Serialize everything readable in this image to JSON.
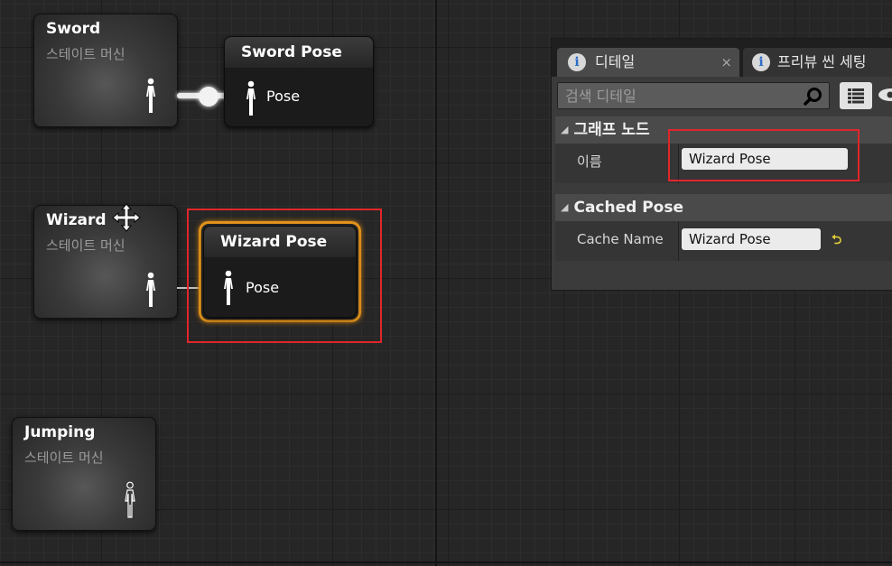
{
  "graph": {
    "state_machines": [
      {
        "title": "Sword",
        "subtitle": "스테이트 머신"
      },
      {
        "title": "Wizard",
        "subtitle": "스테이트 머신"
      },
      {
        "title": "Jumping",
        "subtitle": "스테이트 머신"
      }
    ],
    "pose_nodes": [
      {
        "title": "Sword Pose",
        "pin_label": "Pose"
      },
      {
        "title": "Wizard Pose",
        "pin_label": "Pose"
      }
    ],
    "colors": {
      "selection": "#e5951c",
      "highlight_box": "#e0262b"
    }
  },
  "details_panel": {
    "tabs": [
      {
        "label": "디테일",
        "icon": "info-icon",
        "close": "×"
      },
      {
        "label": "프리뷰 씬 세팅",
        "icon": "info-icon"
      }
    ],
    "search": {
      "placeholder": "검색 디테일"
    },
    "sections": [
      {
        "title": "그래프 노드",
        "property": {
          "label": "이름",
          "value": "Wizard Pose"
        }
      },
      {
        "title": "Cached Pose",
        "property": {
          "label": "Cache Name",
          "value": "Wizard Pose"
        }
      }
    ],
    "reset_icon": "⮌"
  }
}
